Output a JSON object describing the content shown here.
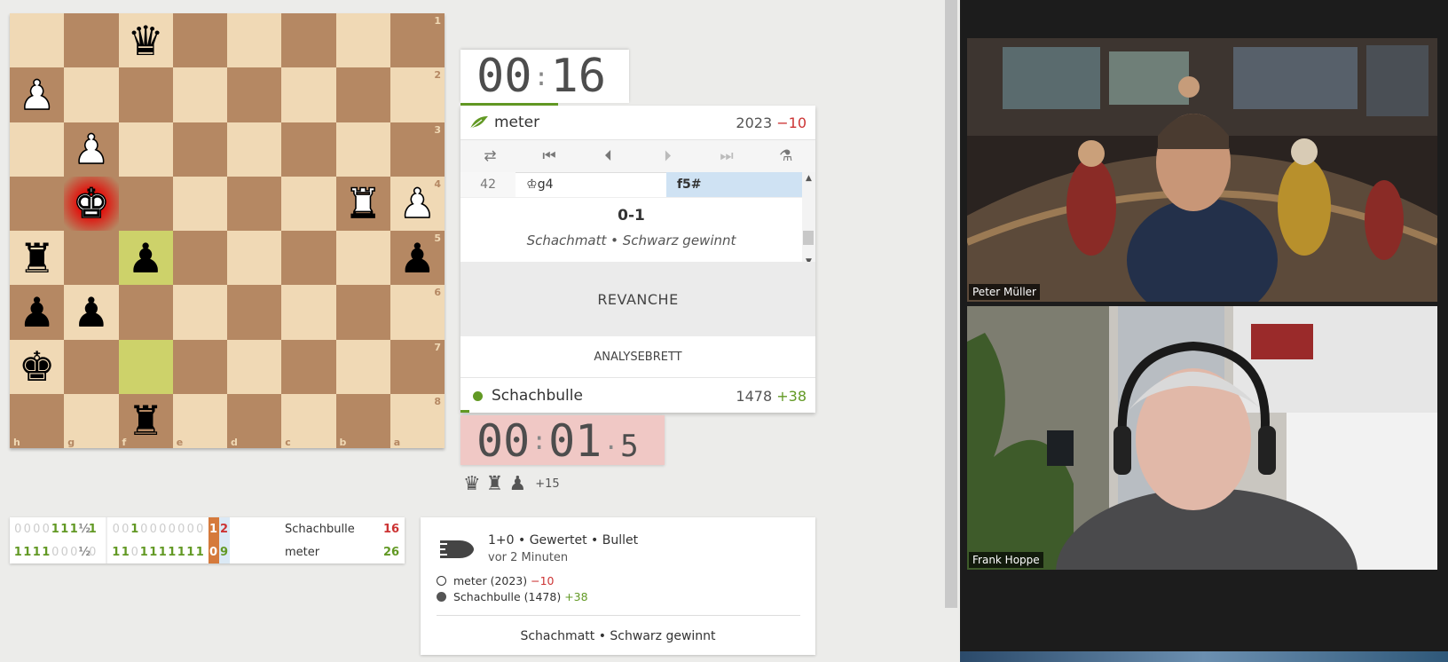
{
  "board": {
    "ranks": [
      "1",
      "2",
      "3",
      "4",
      "5",
      "6",
      "7",
      "8"
    ],
    "files": [
      "h",
      "g",
      "f",
      "e",
      "d",
      "c",
      "b",
      "a"
    ],
    "pieces": [
      {
        "row": 0,
        "col": 2,
        "color": "b",
        "type": "queen",
        "glyph": "♛"
      },
      {
        "row": 1,
        "col": 0,
        "color": "w",
        "type": "pawn",
        "glyph": "♟"
      },
      {
        "row": 2,
        "col": 1,
        "color": "w",
        "type": "pawn",
        "glyph": "♟"
      },
      {
        "row": 3,
        "col": 1,
        "color": "w",
        "type": "king",
        "glyph": "♚"
      },
      {
        "row": 3,
        "col": 6,
        "color": "w",
        "type": "rook",
        "glyph": "♜"
      },
      {
        "row": 3,
        "col": 7,
        "color": "w",
        "type": "pawn",
        "glyph": "♟"
      },
      {
        "row": 4,
        "col": 0,
        "color": "b",
        "type": "rook",
        "glyph": "♜"
      },
      {
        "row": 4,
        "col": 2,
        "color": "b",
        "type": "pawn",
        "glyph": "♟"
      },
      {
        "row": 4,
        "col": 7,
        "color": "b",
        "type": "pawn",
        "glyph": "♟"
      },
      {
        "row": 5,
        "col": 0,
        "color": "b",
        "type": "pawn",
        "glyph": "♟"
      },
      {
        "row": 5,
        "col": 1,
        "color": "b",
        "type": "pawn",
        "glyph": "♟"
      },
      {
        "row": 6,
        "col": 0,
        "color": "b",
        "type": "king",
        "glyph": "♚"
      },
      {
        "row": 7,
        "col": 2,
        "color": "b",
        "type": "rook",
        "glyph": "♜"
      }
    ],
    "last_move_squares": [
      [
        4,
        2
      ],
      [
        6,
        2
      ]
    ],
    "check_square": [
      3,
      1
    ]
  },
  "clock_top": {
    "mm": "00",
    "ss": "16"
  },
  "clock_bottom": {
    "mm": "00",
    "ss": "01",
    "tenths": "5"
  },
  "top_player": {
    "name": "meter",
    "rating": "2023",
    "diff": "−10",
    "icon": "leaf-icon"
  },
  "bottom_player": {
    "name": "Schachbulle",
    "rating": "1478",
    "diff": "+38"
  },
  "controls": [
    {
      "name": "flip-board-button",
      "glyph": "⇄",
      "icon": "flip-icon",
      "dim": false
    },
    {
      "name": "first-move-button",
      "glyph": "⏮",
      "icon": "first-icon",
      "dim": false
    },
    {
      "name": "prev-move-button",
      "glyph": "⏴",
      "icon": "prev-icon",
      "dim": false
    },
    {
      "name": "next-move-button",
      "glyph": "⏵",
      "icon": "next-icon",
      "dim": true
    },
    {
      "name": "last-move-button",
      "glyph": "⏭",
      "icon": "last-icon",
      "dim": true
    },
    {
      "name": "analysis-button",
      "glyph": "⚗",
      "icon": "microscope-icon",
      "dim": false
    }
  ],
  "moves": {
    "index": "42",
    "white": "♔g4",
    "black": "f5#"
  },
  "result": "0-1",
  "status": "Schachmatt • Schwarz gewinnt",
  "rematch_label": "REVANCHE",
  "analysis_label": "ANALYSEBRETT",
  "material": {
    "pieces": [
      "♛",
      "♜",
      "♟"
    ],
    "plus": "+15"
  },
  "crosstable": {
    "rows": [
      {
        "a": [
          "0",
          "0",
          "0",
          "0",
          "1",
          "1",
          "1",
          "½",
          "1"
        ],
        "b": [
          "0",
          "0",
          "1",
          "0",
          "0",
          "0",
          "0",
          "0",
          "0",
          "0"
        ],
        "last": [
          "1",
          "2"
        ],
        "name": "Schachbulle",
        "total": "16"
      },
      {
        "a": [
          "1",
          "1",
          "1",
          "1",
          "0",
          "0",
          "0",
          "½",
          "0"
        ],
        "b": [
          "1",
          "1",
          "0",
          "1",
          "1",
          "1",
          "1",
          "1",
          "1",
          "1"
        ],
        "last": [
          "0",
          "9"
        ],
        "name": "meter",
        "total": "26"
      }
    ]
  },
  "gameinfo": {
    "line1": "1+0 • Gewertet • Bullet",
    "line2": "vor 2 Minuten",
    "white": {
      "label": "meter (2023)",
      "diff": "−10"
    },
    "black": {
      "label": "Schachbulle (1478)",
      "diff": "+38"
    },
    "end": "Schachmatt • Schwarz gewinnt",
    "icon": "bullet-icon"
  },
  "videos": [
    {
      "name": "Peter Müller"
    },
    {
      "name": "Frank Hoppe"
    }
  ]
}
